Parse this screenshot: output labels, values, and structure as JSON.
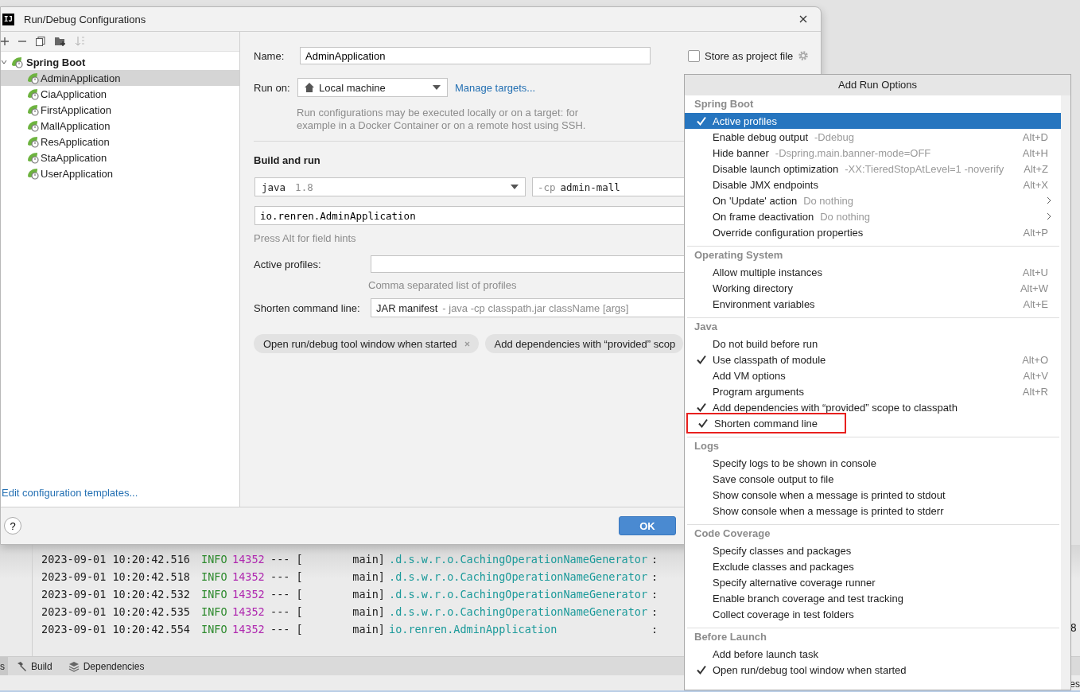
{
  "dialog": {
    "logo_text": "IJ",
    "title": "Run/Debug Configurations",
    "tree": {
      "label": "Spring Boot",
      "expanded": true,
      "children": [
        {
          "label": "AdminApplication",
          "selected": true
        },
        {
          "label": "CiaApplication",
          "selected": false
        },
        {
          "label": "FirstApplication",
          "selected": false
        },
        {
          "label": "MallApplication",
          "selected": false
        },
        {
          "label": "ResApplication",
          "selected": false
        },
        {
          "label": "StaApplication",
          "selected": false
        },
        {
          "label": "UserApplication",
          "selected": false
        }
      ]
    },
    "templates_link": "Edit configuration templates...",
    "form": {
      "name_label": "Name:",
      "name_value": "AdminApplication",
      "store_label": "Store as project file",
      "store_checked": false,
      "run_on_label": "Run on:",
      "run_on_value": "Local machine",
      "manage_link": "Manage targets...",
      "run_on_hint": "Run configurations may be executed locally or on a target: for example in a Docker Container or on a remote host using SSH.",
      "section_title": "Build and run",
      "jdk": {
        "name": "java",
        "version": "1.8"
      },
      "classpath": {
        "prefix": "-cp",
        "value": "admin-mall"
      },
      "main_class": "io.renren.AdminApplication",
      "field_hint": "Press Alt for field hints",
      "active_profiles_label": "Active profiles:",
      "profiles_hint": "Comma separated list of profiles",
      "shorten_label": "Shorten command line:",
      "shorten_value": "JAR manifest",
      "shorten_detail": "- java -cp classpath.jar className [args]",
      "chips": [
        {
          "label": "Open run/debug tool window when started",
          "removable": true
        },
        {
          "label": "Add dependencies with “provided” scop",
          "removable": false
        }
      ]
    },
    "help": "?",
    "ok_button": "OK"
  },
  "console": {
    "lines": [
      {
        "time": "2023-09-01 10:20:42.516",
        "level": "INFO",
        "pid": "14352",
        "sep": "--- [",
        "thread": "main]",
        "logger": ".d.s.w.r.o.CachingOperationNameGenerator",
        "colon": ":"
      },
      {
        "time": "2023-09-01 10:20:42.518",
        "level": "INFO",
        "pid": "14352",
        "sep": "--- [",
        "thread": "main]",
        "logger": ".d.s.w.r.o.CachingOperationNameGenerator",
        "colon": ":"
      },
      {
        "time": "2023-09-01 10:20:42.532",
        "level": "INFO",
        "pid": "14352",
        "sep": "--- [",
        "thread": "main]",
        "logger": ".d.s.w.r.o.CachingOperationNameGenerator",
        "colon": ":"
      },
      {
        "time": "2023-09-01 10:20:42.535",
        "level": "INFO",
        "pid": "14352",
        "sep": "--- [",
        "thread": "main]",
        "logger": ".d.s.w.r.o.CachingOperationNameGenerator",
        "colon": ":"
      },
      {
        "time": "2023-09-01 10:20:42.554",
        "level": "INFO",
        "pid": "14352",
        "sep": "--- [",
        "thread": "main]",
        "logger": "io.renren.AdminApplication",
        "colon": ":"
      }
    ],
    "edge_text": "8"
  },
  "tool_tabs": [
    {
      "label": "s",
      "kind": "plain",
      "selected": true
    },
    {
      "label": "Build",
      "kind": "build",
      "selected": false
    },
    {
      "label": "Dependencies",
      "kind": "deps",
      "selected": false
    }
  ],
  "edge_fragment": "es",
  "popup": {
    "title": "Add Run Options",
    "groups": [
      {
        "title": "Spring Boot",
        "items": [
          {
            "label": "Active profiles",
            "checked": true,
            "selected": true,
            "submenu": false,
            "outlined": false
          },
          {
            "label": "Enable debug output",
            "detail": "-Ddebug",
            "shortcut": "Alt+D",
            "checked": false,
            "selected": false,
            "submenu": false,
            "outlined": false
          },
          {
            "label": "Hide banner",
            "detail": "-Dspring.main.banner-mode=OFF",
            "shortcut": "Alt+H",
            "checked": false,
            "selected": false,
            "submenu": false,
            "outlined": false
          },
          {
            "label": "Disable launch optimization",
            "detail": "-XX:TieredStopAtLevel=1 -noverify",
            "shortcut": "Alt+Z",
            "checked": false,
            "selected": false,
            "submenu": false,
            "outlined": false
          },
          {
            "label": "Disable JMX endpoints",
            "shortcut": "Alt+X",
            "checked": false,
            "selected": false,
            "submenu": false,
            "outlined": false
          },
          {
            "label": "On 'Update' action",
            "detail": "Do nothing",
            "checked": false,
            "selected": false,
            "submenu": true,
            "outlined": false
          },
          {
            "label": "On frame deactivation",
            "detail": "Do nothing",
            "checked": false,
            "selected": false,
            "submenu": true,
            "outlined": false
          },
          {
            "label": "Override configuration properties",
            "shortcut": "Alt+P",
            "checked": false,
            "selected": false,
            "submenu": false,
            "outlined": false
          }
        ]
      },
      {
        "title": "Operating System",
        "items": [
          {
            "label": "Allow multiple instances",
            "shortcut": "Alt+U",
            "checked": false,
            "selected": false,
            "submenu": false,
            "outlined": false
          },
          {
            "label": "Working directory",
            "shortcut": "Alt+W",
            "checked": false,
            "selected": false,
            "submenu": false,
            "outlined": false
          },
          {
            "label": "Environment variables",
            "shortcut": "Alt+E",
            "checked": false,
            "selected": false,
            "submenu": false,
            "outlined": false
          }
        ]
      },
      {
        "title": "Java",
        "items": [
          {
            "label": "Do not build before run",
            "checked": false,
            "selected": false,
            "submenu": false,
            "outlined": false
          },
          {
            "label": "Use classpath of module",
            "shortcut": "Alt+O",
            "checked": true,
            "selected": false,
            "submenu": false,
            "outlined": false
          },
          {
            "label": "Add VM options",
            "shortcut": "Alt+V",
            "checked": false,
            "selected": false,
            "submenu": false,
            "outlined": false
          },
          {
            "label": "Program arguments",
            "shortcut": "Alt+R",
            "checked": false,
            "selected": false,
            "submenu": false,
            "outlined": false
          },
          {
            "label": "Add dependencies with “provided” scope to classpath",
            "checked": true,
            "selected": false,
            "submenu": false,
            "outlined": false
          },
          {
            "label": "Shorten command line",
            "checked": true,
            "selected": false,
            "submenu": false,
            "outlined": true
          }
        ]
      },
      {
        "title": "Logs",
        "items": [
          {
            "label": "Specify logs to be shown in console",
            "checked": false,
            "selected": false,
            "submenu": false,
            "outlined": false
          },
          {
            "label": "Save console output to file",
            "checked": false,
            "selected": false,
            "submenu": false,
            "outlined": false
          },
          {
            "label": "Show console when a message is printed to stdout",
            "checked": false,
            "selected": false,
            "submenu": false,
            "outlined": false
          },
          {
            "label": "Show console when a message is printed to stderr",
            "checked": false,
            "selected": false,
            "submenu": false,
            "outlined": false
          }
        ]
      },
      {
        "title": "Code Coverage",
        "items": [
          {
            "label": "Specify classes and packages",
            "checked": false,
            "selected": false,
            "submenu": false,
            "outlined": false
          },
          {
            "label": "Exclude classes and packages",
            "checked": false,
            "selected": false,
            "submenu": false,
            "outlined": false
          },
          {
            "label": "Specify alternative coverage runner",
            "checked": false,
            "selected": false,
            "submenu": false,
            "outlined": false
          },
          {
            "label": "Enable branch coverage and test tracking",
            "checked": false,
            "selected": false,
            "submenu": false,
            "outlined": false
          },
          {
            "label": "Collect coverage in test folders",
            "checked": false,
            "selected": false,
            "submenu": false,
            "outlined": false
          }
        ]
      },
      {
        "title": "Before Launch",
        "items": [
          {
            "label": "Add before launch task",
            "checked": false,
            "selected": false,
            "submenu": false,
            "outlined": false
          },
          {
            "label": "Open run/debug tool window when started",
            "checked": true,
            "selected": false,
            "submenu": false,
            "outlined": false
          }
        ]
      }
    ]
  }
}
